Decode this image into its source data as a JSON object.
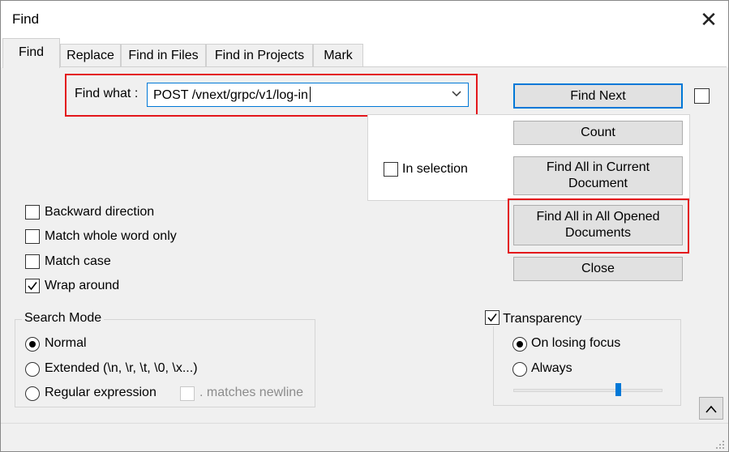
{
  "window": {
    "title": "Find"
  },
  "tabs": [
    {
      "label": "Find"
    },
    {
      "label": "Replace"
    },
    {
      "label": "Find in Files"
    },
    {
      "label": "Find in Projects"
    },
    {
      "label": "Mark"
    }
  ],
  "find_what": {
    "label": "Find what :",
    "value": "POST /vnext/grpc/v1/log-in"
  },
  "buttons": {
    "find_next": "Find Next",
    "count": "Count",
    "find_all_current": "Find All in Current Document",
    "find_all_opened": "Find All in All Opened Documents",
    "close": "Close",
    "collapse": "^"
  },
  "in_selection": {
    "label": "In selection",
    "checked": false
  },
  "options": [
    {
      "label": "Backward direction",
      "checked": false
    },
    {
      "label": "Match whole word only",
      "checked": false
    },
    {
      "label": "Match case",
      "checked": false
    },
    {
      "label": "Wrap around",
      "checked": true
    }
  ],
  "search_mode": {
    "title": "Search Mode",
    "options": [
      {
        "label": "Normal",
        "selected": true
      },
      {
        "label": "Extended (\\n, \\r, \\t, \\0, \\x...)",
        "selected": false
      },
      {
        "label": "Regular expression",
        "selected": false
      }
    ],
    "matches_newline": {
      "label": ". matches newline",
      "checked": false,
      "enabled": false
    }
  },
  "transparency": {
    "label": "Transparency",
    "checked": true,
    "options": [
      {
        "label": "On losing focus",
        "selected": true
      },
      {
        "label": "Always",
        "selected": false
      }
    ],
    "slider_level": 0.7
  },
  "colors": {
    "accent": "#0078d7",
    "highlight_box": "#e3161b"
  },
  "icons": {
    "close": "close-icon",
    "dropdown": "chevron-down-icon",
    "check": "check-icon",
    "collapse": "chevron-up-icon",
    "resize": "resize-grip-icon"
  }
}
